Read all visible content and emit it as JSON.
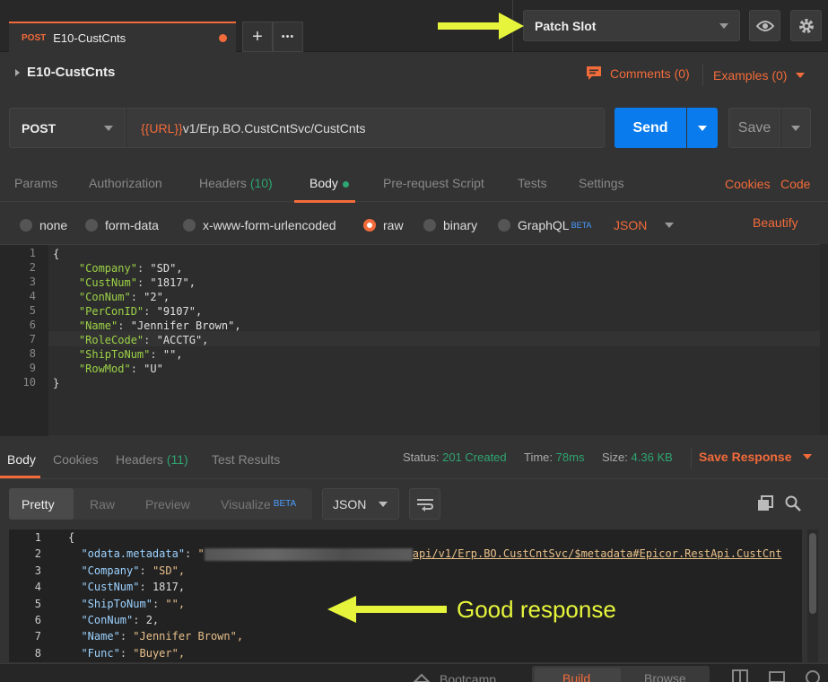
{
  "tabs": {
    "active": {
      "method": "POST",
      "name": "E10-CustCnts"
    },
    "new_tab": "+",
    "more": "•••"
  },
  "environment": {
    "selected": "Patch Slot"
  },
  "request": {
    "title": "E10-CustCnts",
    "comments_label": "Comments (0)",
    "examples_label": "Examples (0)",
    "method": "POST",
    "url_var": "{{URL}}",
    "url_path": "v1/Erp.BO.CustCntSvc/CustCnts",
    "send_label": "Send",
    "save_label": "Save"
  },
  "request_tabs": [
    {
      "label": "Params"
    },
    {
      "label": "Authorization"
    },
    {
      "label": "Headers",
      "count": "(10)"
    },
    {
      "label": "Body"
    },
    {
      "label": "Pre-request Script"
    },
    {
      "label": "Tests"
    },
    {
      "label": "Settings"
    }
  ],
  "request_links": {
    "cookies": "Cookies",
    "code": "Code"
  },
  "body_types": {
    "options": [
      "none",
      "form-data",
      "x-www-form-urlencoded",
      "raw",
      "binary",
      "GraphQL"
    ],
    "selected": "raw",
    "beta": "BETA",
    "format": "JSON",
    "beautify": "Beautify"
  },
  "request_body_lines": [
    {
      "n": "1",
      "text": "{"
    },
    {
      "n": "2",
      "key": "\"Company\"",
      "val": "\"SD\","
    },
    {
      "n": "3",
      "key": "\"CustNum\"",
      "val": "\"1817\","
    },
    {
      "n": "4",
      "key": "\"ConNum\"",
      "val": "\"2\","
    },
    {
      "n": "5",
      "key": "\"PerConID\"",
      "val": "\"9107\","
    },
    {
      "n": "6",
      "key": "\"Name\"",
      "val": "\"Jennifer Brown\","
    },
    {
      "n": "7",
      "key": "\"RoleCode\"",
      "val": "\"ACCTG\","
    },
    {
      "n": "8",
      "key": "\"ShipToNum\"",
      "val": "\"\","
    },
    {
      "n": "9",
      "key": "\"RowMod\"",
      "val": "\"U\""
    },
    {
      "n": "10",
      "text": "}"
    }
  ],
  "response": {
    "tabs": [
      {
        "label": "Body"
      },
      {
        "label": "Cookies"
      },
      {
        "label": "Headers",
        "count": "(11)"
      },
      {
        "label": "Test Results"
      }
    ],
    "status_label": "Status:",
    "status_value": "201 Created",
    "time_label": "Time:",
    "time_value": "78ms",
    "size_label": "Size:",
    "size_value": "4.36 KB",
    "save_response": "Save Response",
    "views": [
      "Pretty",
      "Raw",
      "Preview",
      "Visualize"
    ],
    "visualize_beta": "BETA",
    "format": "JSON",
    "lines": [
      {
        "n": "1",
        "text": "{"
      },
      {
        "n": "2",
        "key": "\"odata.metadata\"",
        "val_suffix": "api/v1/Erp.BO.CustCntSvc/$metadata#Epicor.RestApi.CustCnt"
      },
      {
        "n": "3",
        "key": "\"Company\"",
        "val": "\"SD\","
      },
      {
        "n": "4",
        "key": "\"CustNum\"",
        "val": "1817,"
      },
      {
        "n": "5",
        "key": "\"ShipToNum\"",
        "val": "\"\","
      },
      {
        "n": "6",
        "key": "\"ConNum\"",
        "val": "2,"
      },
      {
        "n": "7",
        "key": "\"Name\"",
        "val": "\"Jennifer Brown\","
      },
      {
        "n": "8",
        "key": "\"Func\"",
        "val": "\"Buyer\","
      }
    ]
  },
  "statusbar": {
    "bootcamp": "Bootcamp",
    "build": "Build",
    "browse": "Browse"
  },
  "annotations": {
    "good_response": "Good response"
  },
  "colors": {
    "accent": "#f26b3a",
    "send": "#097bed",
    "success": "#2fa571",
    "annotation": "#e6f53b"
  }
}
